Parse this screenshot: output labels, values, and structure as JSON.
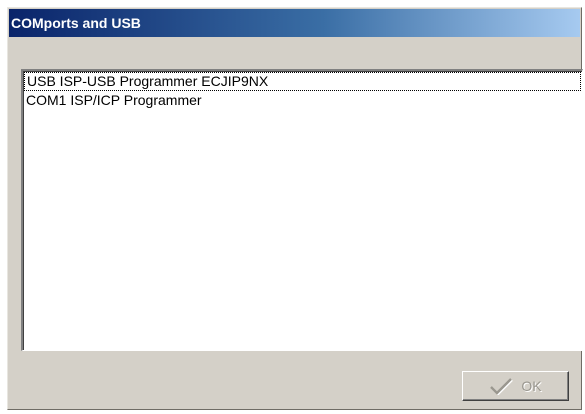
{
  "window": {
    "title": "COMports and USB"
  },
  "device_list": {
    "items": [
      {
        "label": "USB  ISP-USB Programmer ECJIP9NX",
        "focused": true
      },
      {
        "label": "COM1 ISP/ICP Programmer",
        "focused": false
      }
    ]
  },
  "buttons": {
    "ok_label": "OK",
    "ok_icon": "checkmark-icon",
    "ok_enabled": false
  },
  "colors": {
    "title_gradient_start": "#0a246a",
    "title_gradient_end": "#a6caf0",
    "window_face": "#d4d0c8",
    "disabled_text": "#9a978f"
  }
}
